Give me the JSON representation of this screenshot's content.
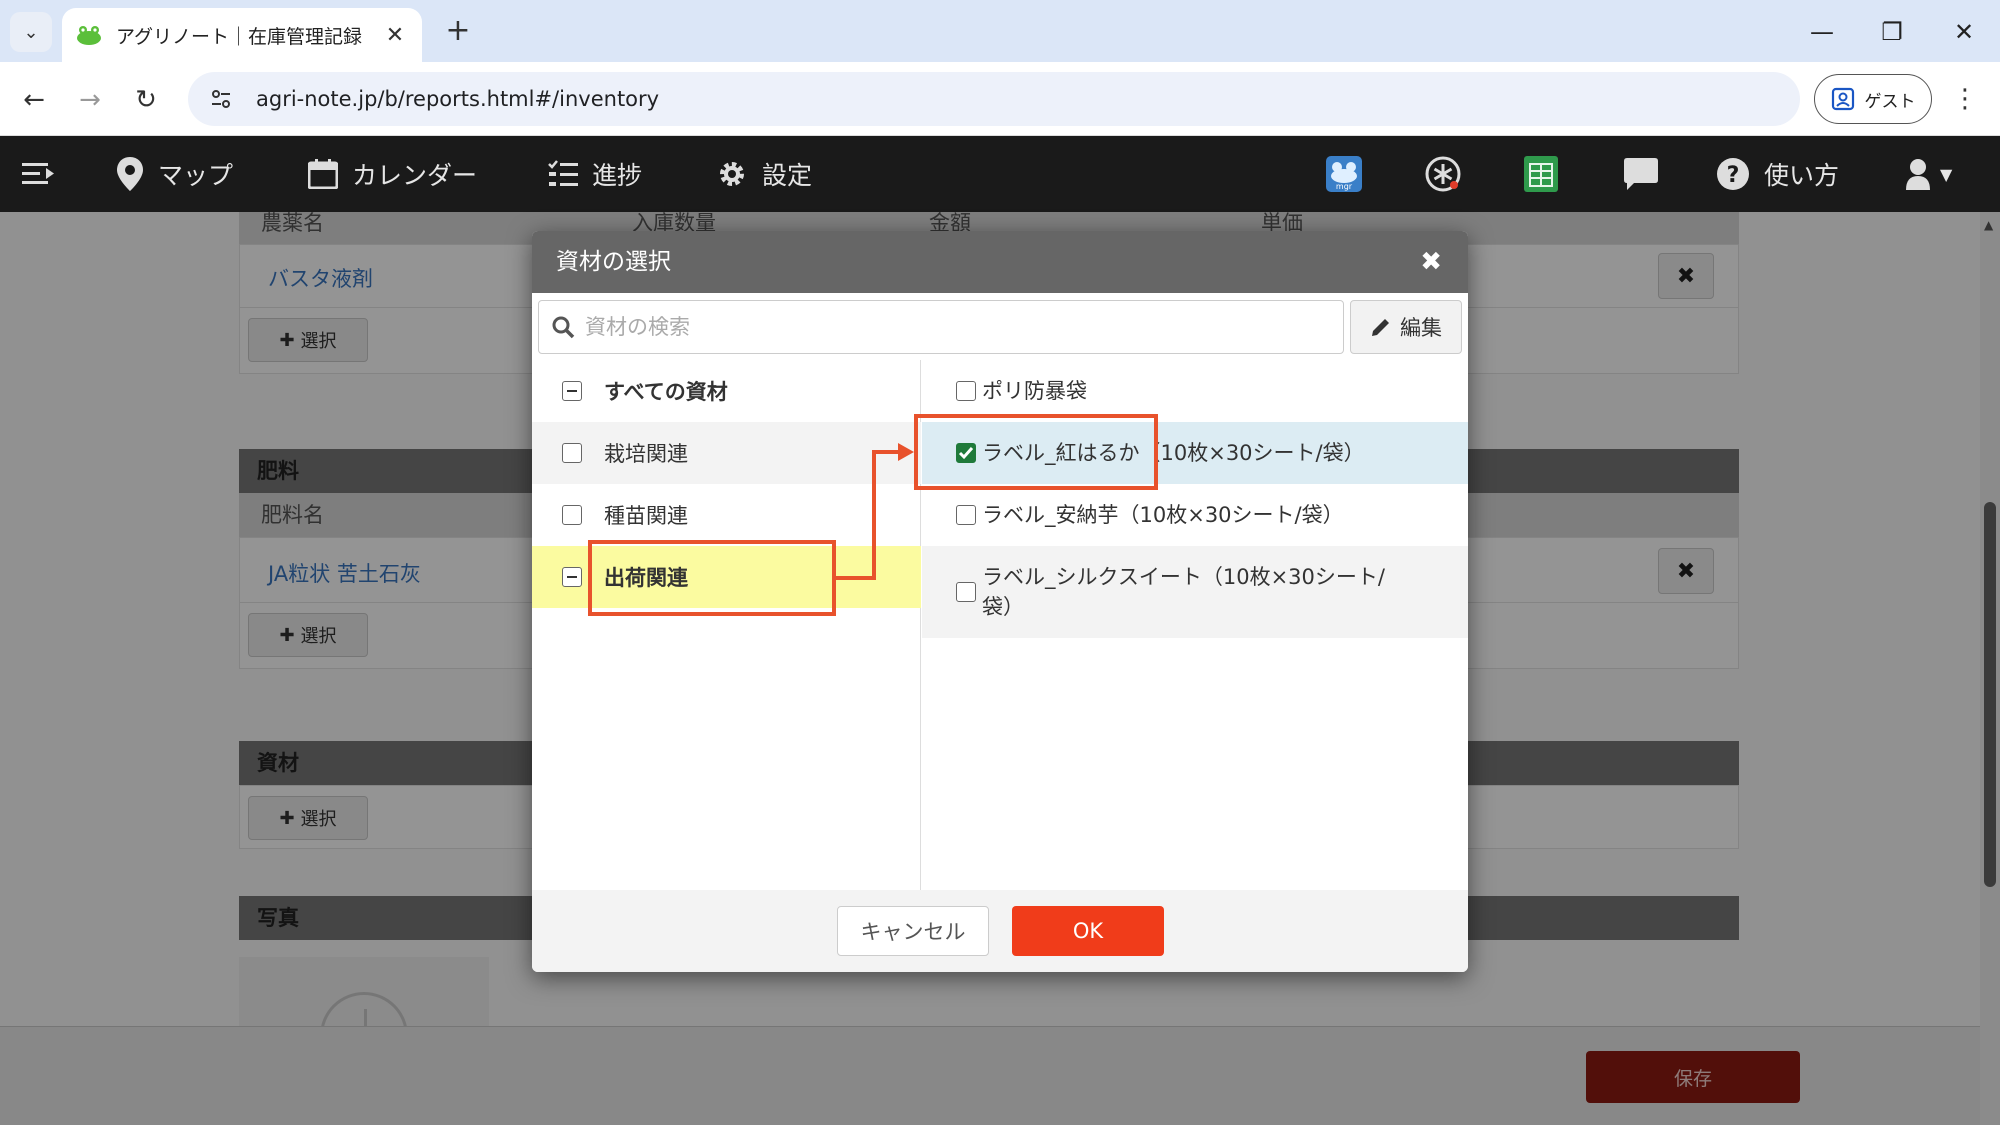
{
  "browser": {
    "tab_title": "アグリノート｜在庫管理記録",
    "url": "agri-note.jp/b/reports.html#/inventory",
    "guest_label": "ゲスト"
  },
  "appnav": {
    "map": "マップ",
    "calendar": "カレンダー",
    "progress": "進捗",
    "settings": "設定",
    "mgr_badge": "mgr",
    "help": "使い方"
  },
  "page": {
    "pesticide": {
      "col_name": "農薬名",
      "col_qty": "入庫数量",
      "col_amount": "金額",
      "col_unit_price": "単価",
      "item": "バスタ液剤"
    },
    "fertilizer": {
      "title": "肥料",
      "col_name": "肥料名",
      "item": "JA粒状 苦土石灰"
    },
    "materials": {
      "title": "資材"
    },
    "photos": {
      "title": "写真"
    },
    "select_label": "選択",
    "save_label": "保存"
  },
  "modal": {
    "title": "資材の選択",
    "search_placeholder": "資材の検索",
    "edit_label": "編集",
    "categories": [
      {
        "label": "すべての資材",
        "state": "indeterminate"
      },
      {
        "label": "栽培関連",
        "state": "unchecked"
      },
      {
        "label": "種苗関連",
        "state": "unchecked"
      },
      {
        "label": "出荷関連",
        "state": "indeterminate"
      }
    ],
    "materials": [
      {
        "label": "ポリ防暴袋",
        "checked": false
      },
      {
        "label": "ラベル_紅はるか（10枚×30シート/袋）",
        "checked": true
      },
      {
        "label": "ラベル_安納芋（10枚×30シート/袋）",
        "checked": false
      },
      {
        "label": "ラベル_シルクスイート（10枚×30シート/袋）",
        "checked": false
      }
    ],
    "cancel_label": "キャンセル",
    "ok_label": "OK"
  },
  "colors": {
    "accent_ok": "#f03c1a",
    "annotation": "#e8522c",
    "active_category": "#fbfba0",
    "selected_row": "#dcecf3"
  }
}
